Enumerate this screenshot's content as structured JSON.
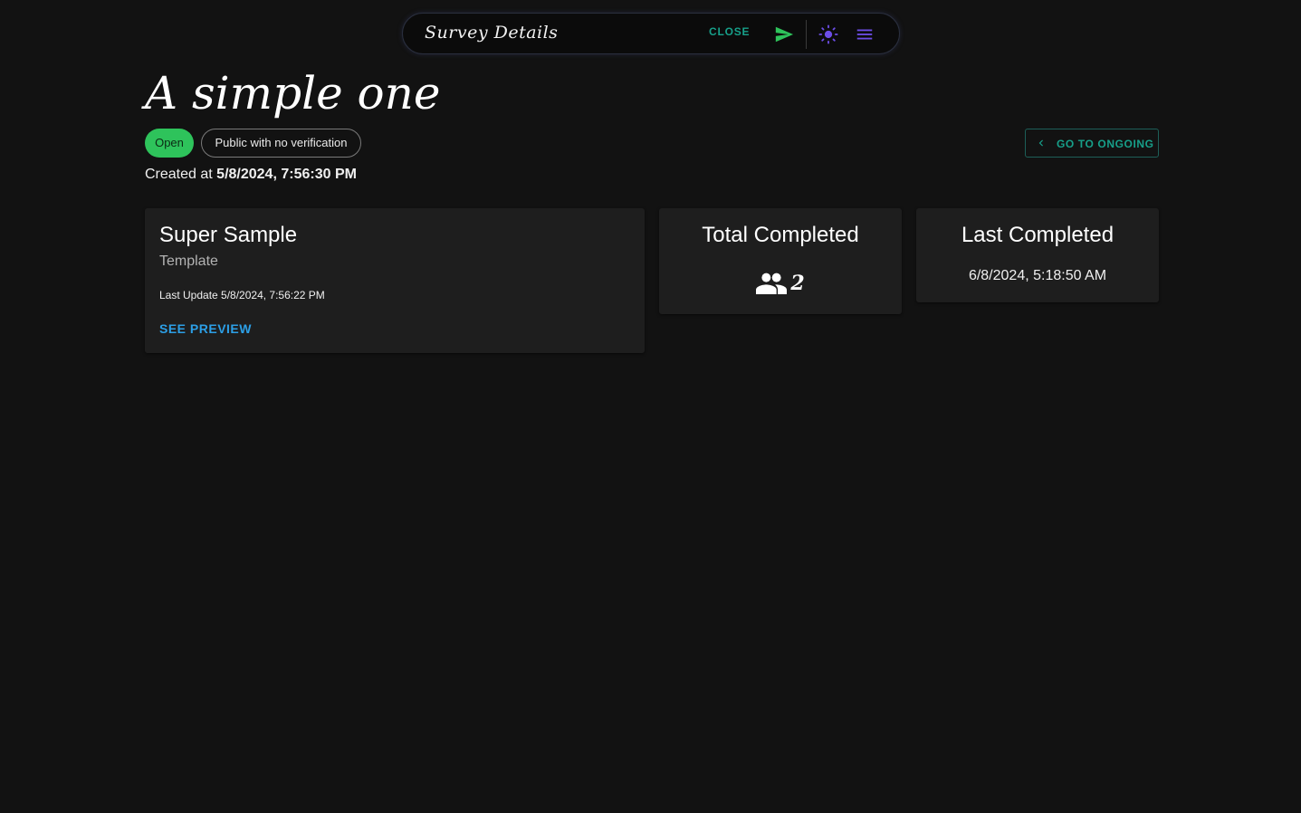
{
  "topbar": {
    "title": "Survey Details",
    "close_label": "CLOSE",
    "icons": [
      "send-icon",
      "theme-sun-icon",
      "menu-icon"
    ]
  },
  "survey": {
    "title": "A simple one",
    "status": "Open",
    "visibility": "Public with no verification",
    "created_label": "Created at",
    "created_value": "5/8/2024, 7:56:30 PM",
    "goto_label": "GO TO ONGOING"
  },
  "sample_card": {
    "name": "Super Sample",
    "subtitle": "Template",
    "last_update": "Last Update 5/8/2024, 7:56:22 PM",
    "preview_label": "SEE PREVIEW"
  },
  "total_card": {
    "title": "Total Completed",
    "count": "2",
    "icon": "people-icon"
  },
  "last_card": {
    "title": "Last Completed",
    "value": "6/8/2024, 5:18:50 AM"
  },
  "colors": {
    "background": "#121212",
    "card": "#1e1e1e",
    "accent_teal": "#17a08a",
    "open_chip": "#2ec35b",
    "link_blue": "#2c9fe6",
    "theme_icon": "#6c4de6",
    "send_icon": "#2ec35b"
  }
}
